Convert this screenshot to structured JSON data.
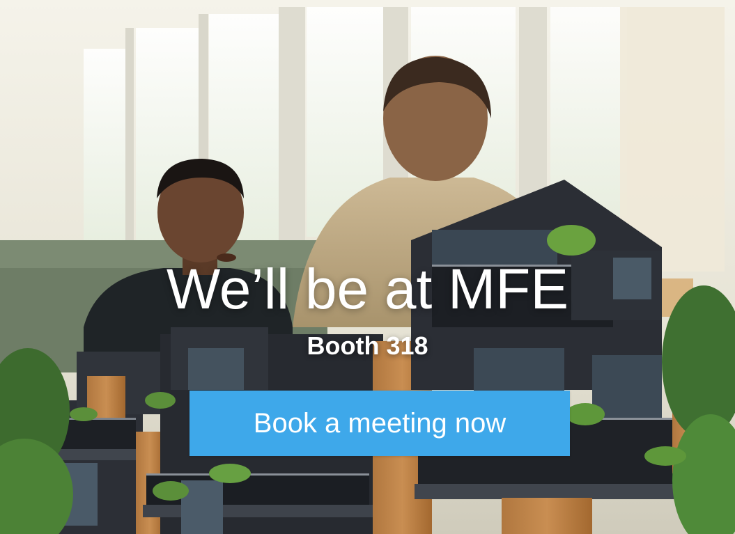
{
  "banner": {
    "headline": "We’ll be at MFE",
    "subline": "Booth 318",
    "cta_label": "Book a meeting now"
  },
  "colors": {
    "cta_background": "#3ea8ea",
    "text": "#ffffff"
  }
}
